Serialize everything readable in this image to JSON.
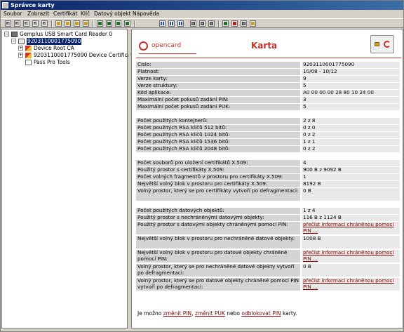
{
  "window": {
    "title": "Správce karty"
  },
  "menu": [
    "Soubor",
    "Zobrazit",
    "Certifikát",
    "Klíč",
    "Datový objekt",
    "Nápověda"
  ],
  "toolbar": {
    "icons": [
      "card-read-icon",
      "card-write-icon",
      "card-erase-icon",
      "card-lock-icon",
      "card-unlock-icon",
      "key-generate-icon",
      "key-import-icon",
      "key-export-icon",
      "key-delete-icon",
      "certificate-view-icon",
      "certificate-import-icon",
      "certificate-export-icon",
      "certificate-delete-icon",
      "data-object-icon",
      "data-import-icon",
      "data-export-icon",
      "refresh-icon",
      "help-icon",
      "print-icon",
      "print-preview-icon"
    ]
  },
  "tree": {
    "reader": "Gemplus USB Smart Card Reader 0",
    "card": "9203110001775090",
    "children": [
      {
        "label": "Device Root CA",
        "icon": "certificate-icon"
      },
      {
        "label": "9203110001775090 Device Certificate",
        "icon": "certificate-icon"
      },
      {
        "label": "Pass Pro Tools",
        "icon": "document-icon"
      }
    ]
  },
  "header": {
    "logo_text": "opencard",
    "title": "Karta"
  },
  "colors": {
    "accent": "#c2312a",
    "label_bg": "#d4d4d4",
    "value_bg": "#e9e9e9",
    "link": "#800000",
    "selection": "#0a246a"
  },
  "rows": [
    {
      "label": "Číslo:",
      "value": "9203110001775090"
    },
    {
      "label": "Platnost:",
      "value": "10/08 - 10/12"
    },
    {
      "label": "Verze karty:",
      "value": "9"
    },
    {
      "label": "Verze struktury:",
      "value": "5"
    },
    {
      "label": "Kód aplikace:",
      "value": "A0 00 00 00 28 80 10 24 00"
    },
    {
      "label": "Maximální počet pokusů zadání PIN:",
      "value": "3"
    },
    {
      "label": "Maximální počet pokusů zadání PUK:",
      "value": "5"
    },
    {
      "label": "Počet použitých kontejnerů:",
      "value": "2 z 8"
    },
    {
      "label": "Počet použitých RSA klíčů 512 bitů:",
      "value": "0 z 0"
    },
    {
      "label": "Počet použitých RSA klíčů 1024 bitů:",
      "value": "0 z 2"
    },
    {
      "label": "Počet použitých RSA klíčů 1536 bitů:",
      "value": "1 z 1"
    },
    {
      "label": "Počet použitých RSA klíčů 2048 bitů:",
      "value": "0 z 2"
    },
    {
      "label": "Počet souborů pro uložení certifikátů X.509:",
      "value": "4"
    },
    {
      "label": "Použitý prostor s certifikáty X.509:",
      "value": "900 B z 9092 B"
    },
    {
      "label": "Počet volných fragmentů v prostoru pro certifikáty X.509:",
      "value": "1"
    },
    {
      "label": "Největší volný blok v prostoru pro certifikáty X.509:",
      "value": "8192 B"
    },
    {
      "label": "Volný prostor, který se pro certifikáty vytvoří po defragmentaci:",
      "value": "0 B"
    },
    {
      "label": "Počet použitých datových objektů:",
      "value": "1 z 4"
    },
    {
      "label": "Použitý prostor s nechráněnými datovými objekty:",
      "value": "116 B z 1124 B"
    },
    {
      "label": "Použitý prostor s datovými objekty chráněnými pomocí PIN:",
      "value": "přečíst informaci chráněnou pomocí PIN ..."
    },
    {
      "label": "Největší volný blok v prostoru pro nechráněné datové objekty:",
      "value": "1008 B"
    },
    {
      "label": "Největší volný blok v prostoru pro datové objekty chráněné pomocí PIN:",
      "value": "přečíst informaci chráněnou pomocí PIN ..."
    },
    {
      "label": "Volný prostor, který se pro nechráněné datové objekty vytvoří po defragmentaci:",
      "value": "0 B"
    },
    {
      "label": "Volný prostor, který se pro datové objekty chráněné pomocí PIN vytvoří po defragmentaci:",
      "value": "přečíst informaci chráněnou pomocí PIN ..."
    }
  ],
  "footer": {
    "prefix": "Je možno",
    "link1": "změnit PIN",
    "sep1": ",",
    "link2": "změnit PUK",
    "mid": "nebo",
    "link3": "odblokovat PIN",
    "suffix": "karty."
  }
}
